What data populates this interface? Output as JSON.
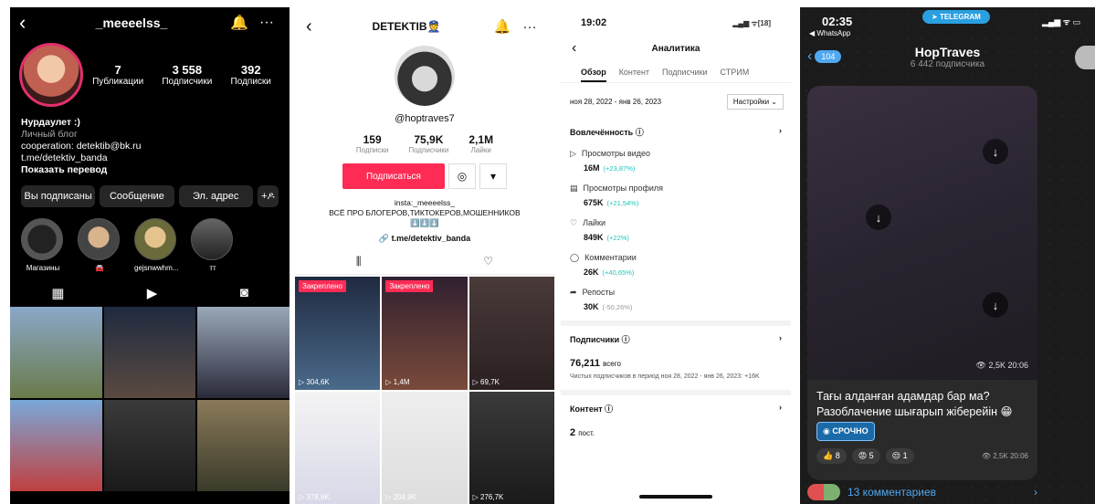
{
  "instagram": {
    "username": "_meeeelss_",
    "stats": [
      {
        "value": "7",
        "label": "Публикации"
      },
      {
        "value": "3 558",
        "label": "Подписчики"
      },
      {
        "value": "392",
        "label": "Подписки"
      }
    ],
    "bio": {
      "name": "Нурдаулет :)",
      "category": "Личный блог",
      "cooperation": "cooperation: detektib@bk.ru",
      "link": "t.me/detektiv_banda",
      "translate": "Показать перевод"
    },
    "buttons": {
      "following": "Вы подписаны",
      "message": "Сообщение",
      "email": "Эл. адрес",
      "add": "+ዶ"
    },
    "highlights": [
      "Магазины",
      "🚘",
      "gejsnwwhm...",
      "тт"
    ]
  },
  "tiktok": {
    "title": "DETEKTIB👮",
    "handle": "@hoptraves7",
    "stats": [
      {
        "value": "159",
        "label": "Подписки"
      },
      {
        "value": "75,9K",
        "label": "Подписчики"
      },
      {
        "value": "2,1M",
        "label": "Лайки"
      }
    ],
    "follow_label": "Подписаться",
    "bio_line1": "insta:_meeeelss_",
    "bio_line2": "ВСЁ ПРО БЛОГЕРОВ,ТИКТОКЕРОВ,МОШЕННИКОВ",
    "bio_line3": "⬇️⬇️⬇️",
    "link": "🔗 t.me/detektiv_banda",
    "pinned_label": "Закреплено",
    "videos": [
      {
        "views": "▷ 304,6K",
        "pinned": true
      },
      {
        "views": "▷ 1,4M",
        "pinned": true
      },
      {
        "views": "▷ 69,7K",
        "pinned": false
      },
      {
        "views": "▷ 378,6K",
        "pinned": false
      },
      {
        "views": "▷ 204,9K",
        "pinned": false
      },
      {
        "views": "▷ 276,7K",
        "pinned": false
      }
    ]
  },
  "analytics": {
    "time": "19:02",
    "battery": "18",
    "title": "Аналитика",
    "tabs": [
      "Обзор",
      "Контент",
      "Подписчики",
      "СТРИМ"
    ],
    "range": "ноя 28, 2022 - янв 26, 2023",
    "settings": "Настройки ⌄",
    "engagement_title": "Вовлечённость ⓘ",
    "metrics": [
      {
        "icon": "▷",
        "label": "Просмотры видео",
        "value": "16M",
        "delta": "(+23,87%)",
        "neg": false
      },
      {
        "icon": "▤",
        "label": "Просмотры профиля",
        "value": "675K",
        "delta": "(+21,54%)",
        "neg": false
      },
      {
        "icon": "♡",
        "label": "Лайки",
        "value": "849K",
        "delta": "(+22%)",
        "neg": false
      },
      {
        "icon": "◯",
        "label": "Комментарии",
        "value": "26K",
        "delta": "(+40,65%)",
        "neg": false
      },
      {
        "icon": "➦",
        "label": "Репосты",
        "value": "30K",
        "delta": "(-50,26%)",
        "neg": true
      }
    ],
    "followers_title": "Подписчики ⓘ",
    "followers_total": "76,211",
    "followers_total_suffix": "всего",
    "followers_note": "Чистых подписчиков в период ноя 28, 2022 - янв 26, 2023: +16K",
    "content_title": "Контент ⓘ",
    "content_count": "2",
    "content_suffix": "пост."
  },
  "telegram": {
    "time": "02:35",
    "back_app": "◀ WhatsApp",
    "pill": "TELEGRAM",
    "badge": "104",
    "channel": "HopTraves",
    "subscribers": "6 442 подписчика",
    "video_meta": "👁 2,5K 20:06",
    "text": "Тағы алданған адамдар бар ма? Разоблачение шығарып жіберейін 😁",
    "tag": "СРОЧНО",
    "reactions": [
      {
        "emoji": "👍",
        "count": "8"
      },
      {
        "emoji": "😡",
        "count": "5"
      },
      {
        "emoji": "😒",
        "count": "1"
      }
    ],
    "post_meta": "👁 2,5K 20:06",
    "comments": "13 комментариев"
  },
  "colors": {
    "tiktok_red": "#fe2c55",
    "telegram_blue": "#4fa8f0",
    "analytics_delta": "#20c4b8"
  }
}
